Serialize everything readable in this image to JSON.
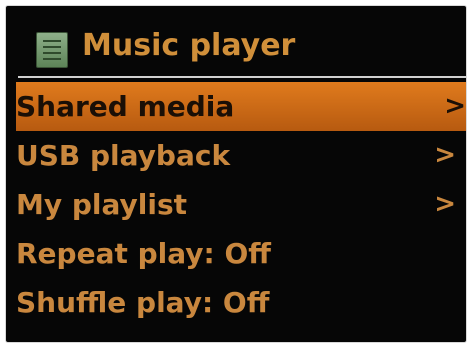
{
  "header": {
    "title": "Music player",
    "icon": "music-list-icon"
  },
  "menu": {
    "items": [
      {
        "label": "Shared media",
        "arrow": ">",
        "selected": true
      },
      {
        "label": "USB playback",
        "arrow": ">"
      },
      {
        "label": "My playlist",
        "arrow": ">"
      },
      {
        "label": "Repeat play: Off"
      },
      {
        "label": "Shuffle play: Off"
      }
    ]
  },
  "colors": {
    "screen_background": "#060606",
    "text_orange": "#c9873e",
    "selection_orange": "#e07b1d",
    "divider": "#cfcfcf",
    "icon_green": "#6f9669"
  }
}
